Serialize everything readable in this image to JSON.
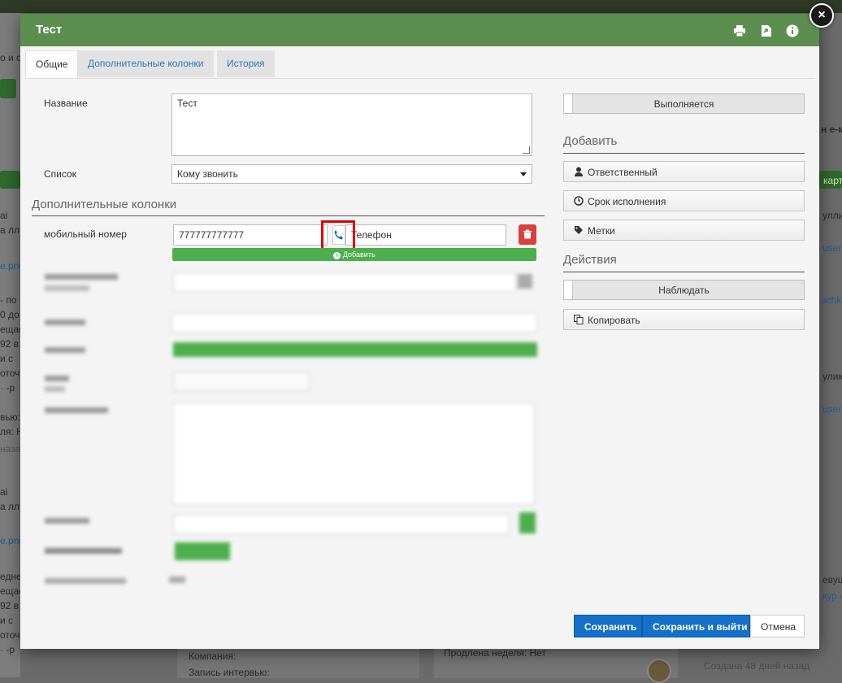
{
  "background": {
    "lines": [
      "о и с",
      "Д",
      "ai",
      "а лл",
      "e.png",
      "- по",
      "0 до",
      "ещае",
      "92 в",
      "и с",
      "оточ",
      "· -р",
      "вью:",
      "ля: Н",
      "назад",
      "ai",
      "а лл",
      "e.png",
      "едне",
      "ещае",
      "92 в",
      "и с",
      "оточ",
      "· -р"
    ],
    "right_lines": [
      "н e-м",
      "карт",
      "улли",
      "user3",
      "ochka",
      "улик",
      "user3",
      "евуш",
      "кур А"
    ],
    "bottom": {
      "company": "Компания:",
      "interview": "Запись интервью:",
      "extended": "Продлена неделя: Нет",
      "created": "Создана 48 дней назад"
    }
  },
  "modal": {
    "title": "Тест",
    "header_icons": [
      "print-icon",
      "export-icon",
      "info-icon"
    ],
    "close": "×",
    "tabs": [
      {
        "label": "Общие",
        "active": true
      },
      {
        "label": "Дополнительные колонки",
        "active": false
      },
      {
        "label": "История",
        "active": false
      }
    ],
    "form": {
      "name_label": "Название",
      "name_value": "Тест",
      "list_label": "Список",
      "list_value": "Кому звонить",
      "extra_section": "Дополнительные колонки",
      "mobile_label": "мобильный номер",
      "mobile_value": "777777777777",
      "phone_type": "Телефон",
      "add_button": "Добавить"
    },
    "right": {
      "status_toggle": "Выполняется",
      "add_section": "Добавить",
      "responsible": "Ответственный",
      "deadline": "Срок исполнения",
      "tags": "Метки",
      "actions_section": "Действия",
      "watch_toggle": "Наблюдать",
      "copy": "Копировать"
    },
    "footer": {
      "save": "Сохранить",
      "save_exit": "Сохранить и выйти",
      "cancel": "Отмена"
    }
  },
  "colors": {
    "header_green": "#5c8f4f",
    "primary_blue": "#1570c9",
    "add_green": "#4cae4c",
    "delete_red": "#d9403a",
    "highlight_red": "#e00000"
  }
}
